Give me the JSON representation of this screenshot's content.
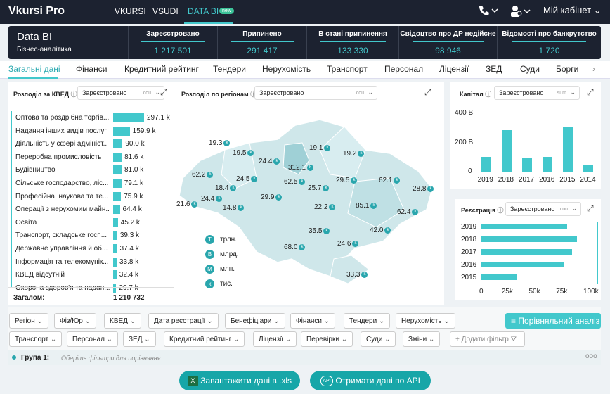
{
  "app": {
    "logo": "Vkursi Pro"
  },
  "topnav": [
    {
      "label": "VKURSI",
      "active": false
    },
    {
      "label": "VSUDI",
      "active": false
    },
    {
      "label": "DATA BI",
      "active": true,
      "badge": "new"
    }
  ],
  "account": {
    "label": "Мій кабінет"
  },
  "banner": {
    "title": "Data BI",
    "subtitle": "Бізнес-аналітика",
    "stats": [
      {
        "label": "Зареєстровано",
        "value": "1 217 501"
      },
      {
        "label": "Припинено",
        "value": "291 417"
      },
      {
        "label": "В стані припинення",
        "value": "133 330"
      },
      {
        "label": "Свідоцтво про ДР недійсне",
        "value": "98 946"
      },
      {
        "label": "Відомості про банкрутство",
        "value": "1 720"
      }
    ]
  },
  "tabs": [
    "Загальні дані",
    "Фінанси",
    "Кредитний рейтинг",
    "Тендери",
    "Нерухомість",
    "Транспорт",
    "Персонал",
    "Ліцензії",
    "ЗЕД",
    "Суди",
    "Борги"
  ],
  "kved_panel": {
    "title": "Розподіл за КВЕД",
    "select": "Зареєстровано",
    "select_mode": "cou",
    "rows": [
      {
        "label": "Оптова та роздрібна торгів...",
        "value": 297.1,
        "text": "297.1 k"
      },
      {
        "label": "Надання інших видів послуг",
        "value": 159.9,
        "text": "159.9 k"
      },
      {
        "label": "Діяльність у сфері адмініст...",
        "value": 90.0,
        "text": "90.0 k"
      },
      {
        "label": "Переробна промисловість",
        "value": 81.6,
        "text": "81.6 k"
      },
      {
        "label": "Будівництво",
        "value": 81.0,
        "text": "81.0 k"
      },
      {
        "label": "Сільське господарство, ліс...",
        "value": 79.1,
        "text": "79.1 k"
      },
      {
        "label": "Професійна, наукова та те...",
        "value": 75.9,
        "text": "75.9 k"
      },
      {
        "label": "Операції з нерухомим майн...",
        "value": 64.4,
        "text": "64.4 k"
      },
      {
        "label": "Освіта",
        "value": 45.2,
        "text": "45.2 k"
      },
      {
        "label": "Транспорт, складське госп...",
        "value": 39.3,
        "text": "39.3 k"
      },
      {
        "label": "Державне управління й об...",
        "value": 37.4,
        "text": "37.4 k"
      },
      {
        "label": "Інформація та телекомунік...",
        "value": 33.8,
        "text": "33.8 k"
      },
      {
        "label": "КВЕД відсутній",
        "value": 32.4,
        "text": "32.4 k"
      },
      {
        "label": "Охорона здоров'я та надан...",
        "value": 29.7,
        "text": "29.7 k"
      }
    ],
    "total_label": "Загалом:",
    "total_value": "1 210 732"
  },
  "region_panel": {
    "title": "Розподіл по регіонам",
    "select": "Зареєстровано",
    "select_mode": "cou",
    "values": [
      "19.3",
      "19.5",
      "24.4",
      "312.1",
      "19.1",
      "19.2",
      "62.2",
      "24.5",
      "18.4",
      "62.5",
      "25.7",
      "29.5",
      "62.1",
      "28.8",
      "24.4",
      "21.6",
      "14.8",
      "29.9",
      "22.2",
      "85.1",
      "62.4",
      "35.5",
      "42.0",
      "24.6",
      "68.0",
      "33.3"
    ],
    "unit_marker": "k",
    "legend": [
      {
        "sym": "T",
        "label": "трлн."
      },
      {
        "sym": "B",
        "label": "млрд."
      },
      {
        "sym": "M",
        "label": "млн."
      },
      {
        "sym": "k",
        "label": "тис."
      }
    ]
  },
  "capital_panel": {
    "title": "Капітал",
    "select": "Зареєстровано",
    "select_mode": "sum",
    "yticks": [
      "400 B",
      "200 B",
      "0"
    ]
  },
  "registration_panel": {
    "title": "Реєстрація",
    "select": "Зареєстровано",
    "select_mode": "cou",
    "xticks": [
      "0",
      "25k",
      "50k",
      "75k",
      "100k"
    ]
  },
  "chart_data": [
    {
      "type": "bar",
      "title": "Капітал",
      "categories": [
        "2019",
        "2018",
        "2017",
        "2016",
        "2015",
        "2014"
      ],
      "values": [
        100,
        285,
        90,
        100,
        305,
        45
      ],
      "ylim": [
        0,
        400
      ],
      "yunit": "B"
    },
    {
      "type": "bar",
      "orientation": "horizontal",
      "title": "Реєстрація",
      "categories": [
        "2019",
        "2018",
        "2017",
        "2016",
        "2015"
      ],
      "values": [
        79000,
        88000,
        83000,
        76000,
        33000
      ],
      "xlim": [
        0,
        100000
      ]
    }
  ],
  "filters_row1": [
    "Регіон",
    "Фіз/Юр",
    "КВЕД",
    "Дата реєстрації",
    "Бенефіціари",
    "Фінанси",
    "Тендери",
    "Нерухомість"
  ],
  "filters_row2": [
    "Транспорт",
    "Персонал",
    "ЗЕД",
    "Кредитний рейтинг",
    "Ліцензії",
    "Перевірки",
    "Суди",
    "Зміни"
  ],
  "compare_button": "Порівняльний аналіз",
  "add_filter": "Додати фільтр",
  "group": {
    "label": "Група 1:",
    "placeholder": "Оберіть фільтри для порівняння"
  },
  "buttons": {
    "download": "Завантажити дані в .xls",
    "api": "Отримати дані по API",
    "api_icon_text": "API"
  },
  "colors": {
    "accent": "#42c8cc",
    "dark": "#1c2230",
    "button": "#17a6a8"
  }
}
